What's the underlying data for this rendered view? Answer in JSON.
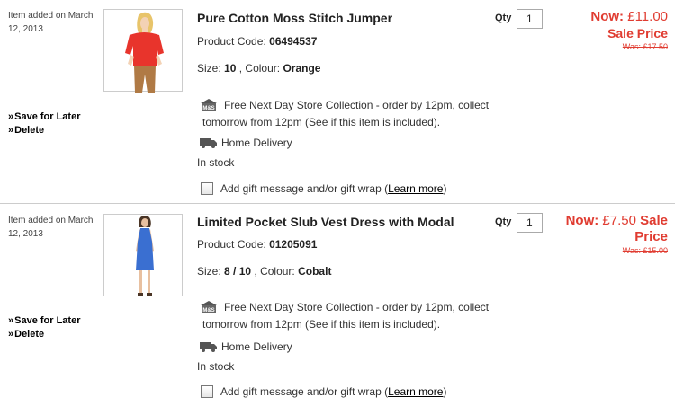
{
  "items": [
    {
      "added_text": "Item added on March 12, 2013",
      "title": "Pure Cotton Moss Stitch Jumper",
      "code_label": "Product Code:",
      "code": "06494537",
      "size_label": "Size:",
      "size": "10",
      "colour_label": ", Colour:",
      "colour": "Orange",
      "store_text_1": "Free Next Day Store Collection - order by 12pm, collect",
      "store_text_2": "tomorrow from 12pm (",
      "store_link": "See if this item is included",
      "store_text_3": ").",
      "delivery_label": "Home Delivery",
      "stock": "In stock",
      "gift_text": "Add gift message and/or gift wrap (",
      "gift_link": "Learn more",
      "gift_close": ")",
      "qty_label": "Qty",
      "qty": "1",
      "now_label": "Now:",
      "now_price": "£11.00",
      "sale_label": "Sale Price",
      "was": "Was: £17.50",
      "save_later": "Save for Later",
      "delete": "Delete",
      "product_colour": "#e8342c"
    },
    {
      "added_text": "Item added on March 12, 2013",
      "title": "Limited Pocket Slub Vest Dress with Modal",
      "code_label": "Product Code:",
      "code": "01205091",
      "size_label": "Size:",
      "size": "8 / 10",
      "colour_label": ", Colour:",
      "colour": "Cobalt",
      "store_text_1": "Free Next Day Store Collection - order by 12pm, collect",
      "store_text_2": "tomorrow from 12pm (",
      "store_link": "See if this item is included",
      "store_text_3": ").",
      "delivery_label": "Home Delivery",
      "stock": "In stock",
      "gift_text": "Add gift message and/or gift wrap (",
      "gift_link": "Learn more",
      "gift_close": ")",
      "qty_label": "Qty",
      "qty": "1",
      "now_label": "Now:",
      "now_price": "£7.50",
      "sale_label": "Sale Price",
      "was": "Was: £15.00",
      "save_later": "Save for Later",
      "delete": "Delete",
      "product_colour": "#3a6fd1"
    }
  ],
  "colors": {
    "price_red": "#e03c31",
    "divider": "#cccccc"
  },
  "icons": {
    "store": "ms-store-icon",
    "delivery": "delivery-truck-icon"
  }
}
